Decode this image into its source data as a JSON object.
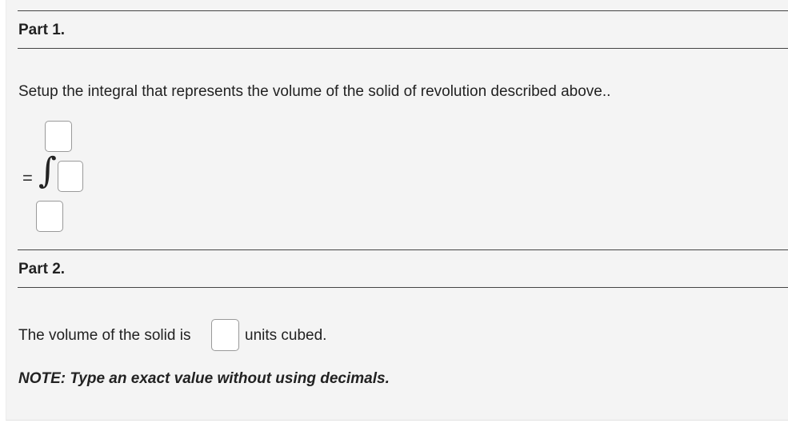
{
  "part1": {
    "title": "Part 1.",
    "prompt": "Setup the integral that represents the volume of the solid of revolution described above..",
    "equals_sign": "=",
    "integral_symbol": "∫",
    "upper_limit_value": "",
    "integrand_value": "",
    "lower_limit_value": ""
  },
  "part2": {
    "title": "Part 2.",
    "sentence_before": "The volume of the solid is",
    "answer_value": "",
    "sentence_after": "units cubed.",
    "note": "NOTE: Type an exact value without using decimals."
  }
}
